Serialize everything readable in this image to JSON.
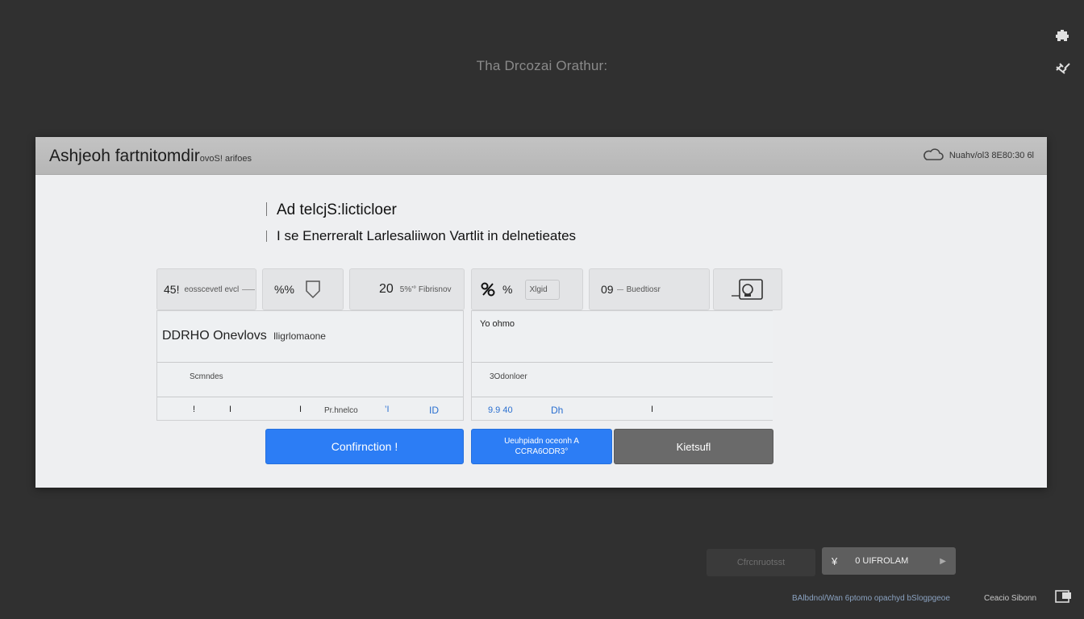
{
  "top": {
    "title": "Tha Drcozai Orathur:"
  },
  "corner_icons": [
    "puzzle-icon",
    "link-icon"
  ],
  "dialog": {
    "title": "Ashjeoh fartnitomdir",
    "title_small": "ovoS! arifoes",
    "status_text": "Nuahv/ol3 8E80:30 6l",
    "heading": "Ad telcjS:licticloer",
    "subheading": "I se Enerreralt Larlesaliiwon Vartlit in delnetieates"
  },
  "tiles": [
    {
      "value": "45!",
      "label": "eosscevetl evcl"
    },
    {
      "value": "%%",
      "icon": "down-arrow-icon"
    },
    {
      "value": "20",
      "label": "5%'° Fibrisnov"
    },
    {
      "value": "%",
      "icon": "percent-icon",
      "label": "Xlgid"
    },
    {
      "value": "09",
      "label": "Buedtiosr"
    },
    {
      "icon": "drive-icon"
    }
  ],
  "left_panel": {
    "title": "DDRHO Onevlovs",
    "title_small": "lligrlomaone",
    "row2": "Scmndes",
    "footer": [
      "!",
      "I",
      "I",
      "Pr.hnelco",
      "’I",
      "ID"
    ]
  },
  "right_panel": {
    "row1": "Yo ohmo",
    "row2": "3Odonloer",
    "footer": [
      "9.9 40",
      "Dh",
      "I"
    ]
  },
  "buttons": {
    "confirm": "Confirnction !",
    "secondary_line1": "Ueuhpiadn oceonh A",
    "secondary_line2": "CCRA6ODR3°",
    "third": "Kietsufl"
  },
  "bottom": {
    "btn1": "Cfrcnruotsst",
    "btn2_icon": "currency-icon",
    "btn2": "0 UIFROLAM",
    "status_left": "BAlbdnol/Wan 6ptomo opachyd bSlogpgeoe",
    "status_right": "Ceacio Sibonn"
  },
  "colors": {
    "accent_blue": "#2c7df5",
    "bg": "#303030"
  }
}
